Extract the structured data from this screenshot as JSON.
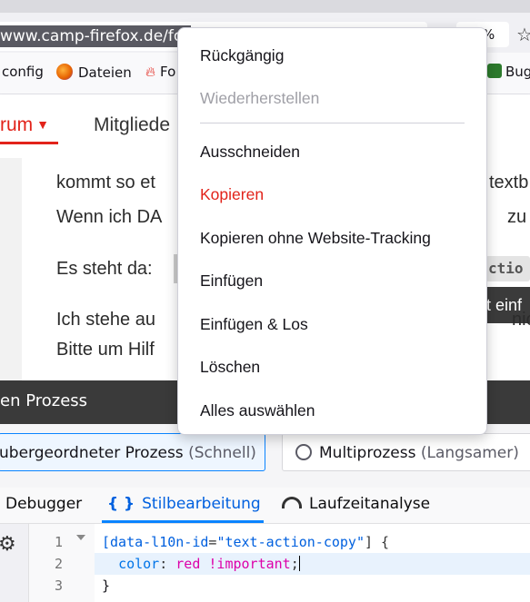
{
  "browser": {
    "url_fragment": "www.camp-firefox.de/fo",
    "zoom": "%",
    "bookmarks": {
      "config": "config",
      "dateien": "Dateien",
      "fo": "Fo",
      "bug": "Bug"
    }
  },
  "site_nav": {
    "forum": "rum",
    "mitglieder": "Mitgliede"
  },
  "post": {
    "line1_left": "kommt so et",
    "line1_right": "textb",
    "line2_left": "Wenn ich DA",
    "line2_right": "zu er",
    "line3_left": "Es steht da:",
    "code_chip": "ctio",
    "tooltip": "t einf",
    "line4_left": "Ich stehe au",
    "line4_right": "nich",
    "line5_left": "Bitte um Hilf"
  },
  "dark_bar": {
    "title": "en Prozess"
  },
  "process_options": {
    "single_label": "ubergeordneter Prozess",
    "single_hint": "(Schnell)",
    "multi_label": "Multiprozess",
    "multi_hint": "(Langsamer)"
  },
  "devtools": {
    "tabs": {
      "debugger": "Debugger",
      "style_editor": "Stilbearbeitung",
      "performance": "Laufzeitanalyse"
    },
    "editor": {
      "line_numbers": [
        "1",
        "2",
        "3"
      ],
      "line1_open": "[",
      "line1_attr": "data-l10n-id",
      "line1_eq": "=",
      "line1_str": "\"text-action-copy\"",
      "line1_close": "] {",
      "line2_prop": "color",
      "line2_colon": ": ",
      "line2_val": "red !important",
      "line2_semi": ";",
      "line3": "}"
    }
  },
  "context_menu": {
    "undo": "Rückgängig",
    "redo": "Wiederherstellen",
    "cut": "Ausschneiden",
    "copy": "Kopieren",
    "copy_no_tracking": "Kopieren ohne Website-Tracking",
    "paste": "Einfügen",
    "paste_and_go": "Einfügen & Los",
    "delete": "Löschen",
    "select_all": "Alles auswählen"
  },
  "colors": {
    "accent_red": "#e2231a",
    "accent_blue": "#0a84ff"
  }
}
